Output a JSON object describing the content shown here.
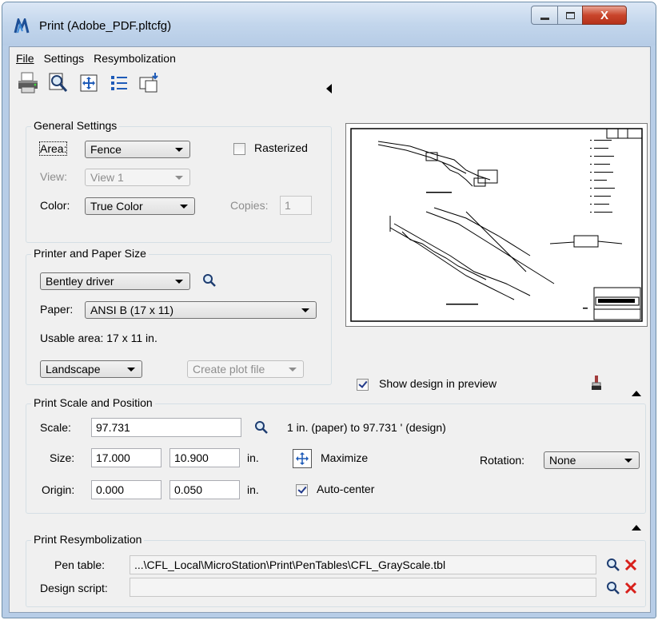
{
  "window": {
    "title": "Print  (Adobe_PDF.pltcfg)",
    "close_glyph": "X"
  },
  "menu": [
    "File",
    "Settings",
    "Resymbolization"
  ],
  "toolbar": {
    "icons": [
      "printer-icon",
      "preview-magnifier-icon",
      "maximize-icon",
      "list-icon",
      "page-setup-icon"
    ]
  },
  "general": {
    "title": "General Settings",
    "area_label": "Area:",
    "area_value": "Fence",
    "rasterized_label": "Rasterized",
    "rasterized_checked": false,
    "view_label": "View:",
    "view_value": "View 1",
    "color_label": "Color:",
    "color_value": "True Color",
    "copies_label": "Copies:",
    "copies_value": "1"
  },
  "printer": {
    "title": "Printer and Paper Size",
    "driver": "Bentley driver",
    "paper_label": "Paper:",
    "paper_value": "ANSI B (17 x 11)",
    "usable_area": "Usable area:  17 x 11 in.",
    "orientation": "Landscape",
    "create_plot_file": "Create plot file"
  },
  "preview": {
    "show_design_label": "Show design in preview",
    "show_design_checked": true
  },
  "scale": {
    "title": "Print Scale and Position",
    "scale_label": "Scale:",
    "scale_value": "97.731",
    "scale_desc": "1 in. (paper) to 97.731 ' (design)",
    "size_label": "Size:",
    "size_w": "17.000",
    "size_h": "10.900",
    "size_unit": "in.",
    "maximize_label": "Maximize",
    "rotation_label": "Rotation:",
    "rotation_value": "None",
    "origin_label": "Origin:",
    "origin_x": "0.000",
    "origin_y": "0.050",
    "origin_unit": "in.",
    "autocenter_label": "Auto-center",
    "autocenter_checked": true
  },
  "resym": {
    "title": "Print Resymbolization",
    "pen_table_label": "Pen table:",
    "pen_table_value": "...\\CFL_Local\\MicroStation\\Print\\PenTables\\CFL_GrayScale.tbl",
    "design_script_label": "Design script:",
    "design_script_value": ""
  },
  "colors": {
    "accent_blue": "#1e5bb8",
    "delete_red": "#d8201b"
  }
}
